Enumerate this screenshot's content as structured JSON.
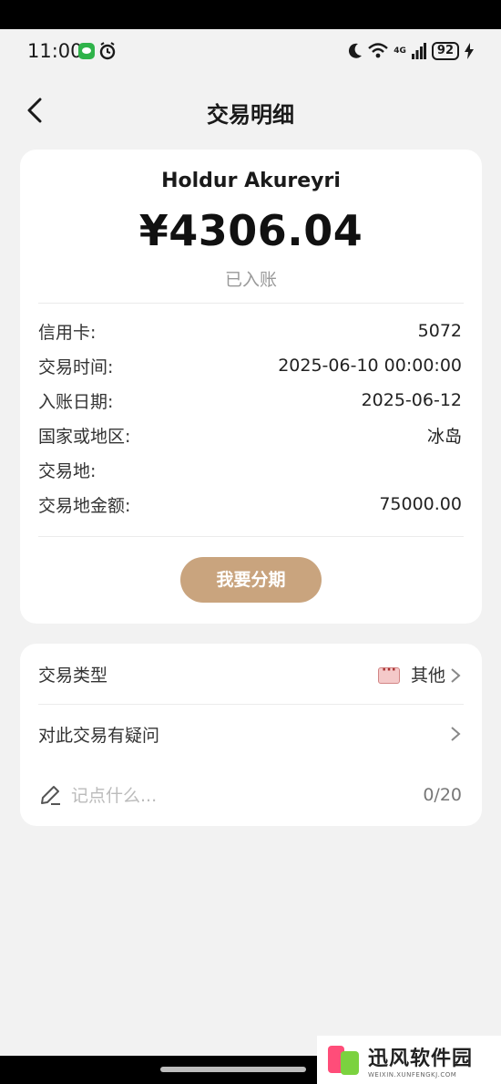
{
  "status_bar": {
    "time": "11:00",
    "network": "4G",
    "battery": "92"
  },
  "nav": {
    "title": "交易明细"
  },
  "transaction": {
    "merchant": "Holdur Akureyri",
    "amount": "¥4306.04",
    "status": "已入账",
    "details": [
      {
        "label": "信用卡:",
        "value": "5072"
      },
      {
        "label": "交易时间:",
        "value": "2025-06-10 00:00:00"
      },
      {
        "label": "入账日期:",
        "value": "2025-06-12"
      },
      {
        "label": "国家或地区:",
        "value": "冰岛"
      },
      {
        "label": "交易地:",
        "value": ""
      },
      {
        "label": "交易地金额:",
        "value": "75000.00"
      }
    ],
    "installment_button": "我要分期"
  },
  "options": {
    "type_label": "交易类型",
    "type_value": "其他",
    "dispute_label": "对此交易有疑问",
    "note_placeholder": "记点什么...",
    "note_count": "0/20"
  },
  "watermark": {
    "name": "迅风软件园",
    "url": "WEIXIN.XUNFENGKJ.COM"
  },
  "colors": {
    "accent": "#c9a47e",
    "background": "#f2f2f2"
  }
}
